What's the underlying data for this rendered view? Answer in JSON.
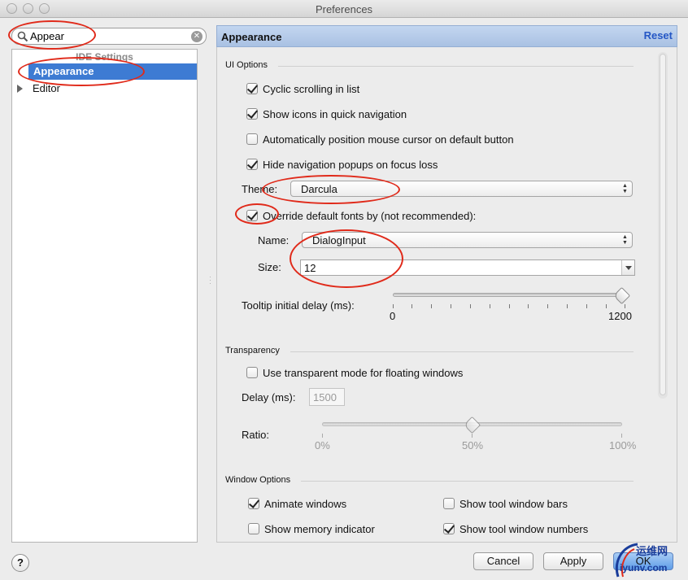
{
  "window": {
    "title": "Preferences"
  },
  "search": {
    "value": "Appear"
  },
  "tree": {
    "group_label": "IDE Settings",
    "selected_item": "Appearance",
    "items": [
      {
        "label": "Editor"
      }
    ]
  },
  "panel": {
    "title": "Appearance",
    "reset_label": "Reset"
  },
  "ui_options": {
    "label": "UI Options",
    "checks": [
      {
        "label": "Cyclic scrolling in list",
        "checked": true
      },
      {
        "label": "Show icons in quick navigation",
        "checked": true
      },
      {
        "label": "Automatically position mouse cursor on default button",
        "checked": false
      },
      {
        "label": "Hide navigation popups on focus loss",
        "checked": true
      }
    ],
    "theme_label": "Theme:",
    "theme_value": "Darcula",
    "override_label": "Override default fonts by (not recommended):",
    "override_checked": true,
    "name_label": "Name:",
    "name_value": "DialogInput",
    "size_label": "Size:",
    "size_value": "12",
    "tooltip_label": "Tooltip initial delay (ms):",
    "tooltip_min": "0",
    "tooltip_max": "1200",
    "tooltip_value": 1200
  },
  "transparency": {
    "label": "Transparency",
    "check_label": "Use transparent mode for floating windows",
    "checked": false,
    "delay_label": "Delay (ms):",
    "delay_value": "1500",
    "ratio_label": "Ratio:",
    "ratio_ticks": [
      "0%",
      "50%",
      "100%"
    ],
    "ratio_value": 50
  },
  "window_options": {
    "label": "Window Options",
    "checks": [
      {
        "label": "Animate windows",
        "checked": true
      },
      {
        "label": "Show tool window bars",
        "checked": false
      },
      {
        "label": "Show memory indicator",
        "checked": false
      },
      {
        "label": "Show tool window numbers",
        "checked": true
      }
    ]
  },
  "buttons": {
    "help": "?",
    "cancel": "Cancel",
    "apply": "Apply",
    "ok": "OK"
  },
  "watermark": {
    "text": "运维网",
    "sub": "iyunv.com"
  },
  "colors": {
    "selection": "#3d7bd3",
    "annotation": "#e02a1a",
    "header": "#b7cdea",
    "link": "#2557c5"
  }
}
